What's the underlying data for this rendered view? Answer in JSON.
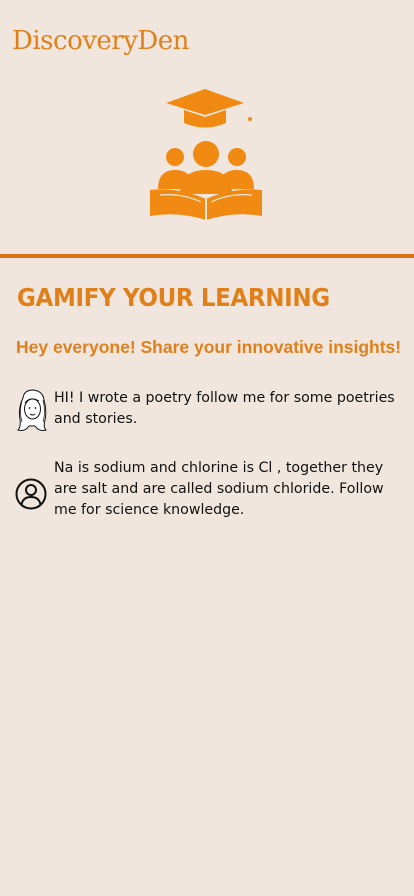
{
  "app": {
    "brand_name": "DiscoveryDen",
    "accent_color": "#E0801A",
    "background_color": "#F0E6DD",
    "hero_icon": "graduation-cap-students-book-icon"
  },
  "main": {
    "headline": "GAMIFY YOUR LEARNING",
    "subheadline": "Hey everyone! Share your innovative insights!"
  },
  "posts": [
    {
      "avatar_icon": "sketch-girl-avatar-icon",
      "text": "HI!  I  wrote a poetry follow me for some poetries and stories."
    },
    {
      "avatar_icon": "user-outline-avatar-icon",
      "text": "Na is sodium and  chlorine is Cl , together they are salt and are called sodium chloride. Follow me for science knowledge."
    }
  ]
}
